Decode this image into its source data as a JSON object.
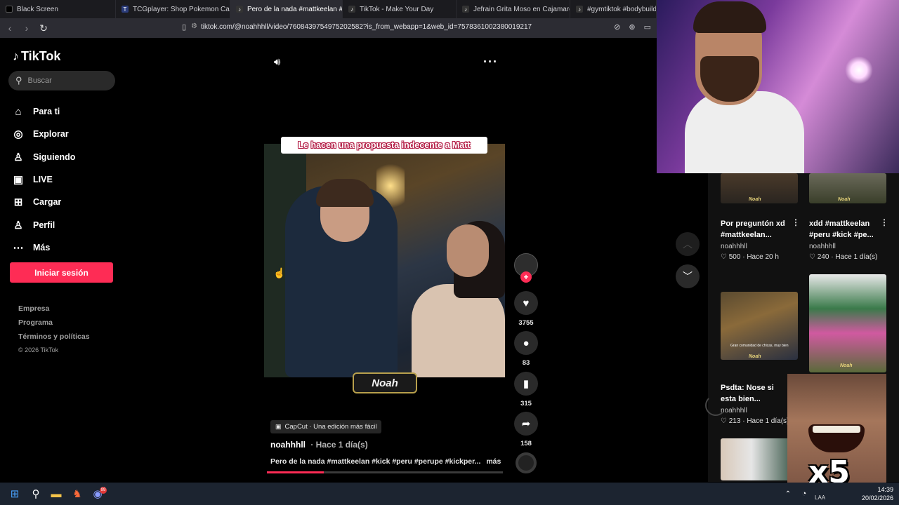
{
  "browser": {
    "tabs": [
      {
        "label": "Black Screen",
        "icon": "black-square-icon",
        "active": false
      },
      {
        "label": "TCGplayer: Shop Pokemon Cards, Pe",
        "icon": "tcg-icon",
        "active": false
      },
      {
        "label": "Pero de la nada #mattkeelan #k",
        "icon": "tiktok-icon",
        "active": true
      },
      {
        "label": "TikTok - Make Your Day",
        "icon": "tiktok-icon",
        "active": false
      },
      {
        "label": "Jefrain Grita Moso en Cajamarca | Ti",
        "icon": "tiktok-icon",
        "active": false
      },
      {
        "label": "#gymtiktok #bodybuilding",
        "icon": "tiktok-icon",
        "active": false
      }
    ],
    "url": "tiktok.com/@noahhhll/video/7608439754975202582?is_from_webapp=1&web_id=7578361002380019217"
  },
  "sidebar": {
    "logo": "TikTok",
    "search_placeholder": "Buscar",
    "nav": [
      {
        "label": "Para ti",
        "icon": "home-icon"
      },
      {
        "label": "Explorar",
        "icon": "compass-icon"
      },
      {
        "label": "Siguiendo",
        "icon": "following-icon"
      },
      {
        "label": "LIVE",
        "icon": "live-icon"
      },
      {
        "label": "Cargar",
        "icon": "upload-icon"
      },
      {
        "label": "Perfil",
        "icon": "profile-icon"
      },
      {
        "label": "Más",
        "icon": "more-icon"
      }
    ],
    "login_label": "Iniciar sesión",
    "footer": {
      "company": "Empresa",
      "program": "Programa",
      "terms": "Términos y políticas",
      "copyright": "© 2026 TikTok"
    }
  },
  "video": {
    "overlay_caption": "Le hacen una propuesta indecente a Matt",
    "watermark": "Noah",
    "likes": "3755",
    "comments": "83",
    "saves": "315",
    "shares": "158",
    "capcut": "CapCut · Una edición más fácil",
    "author": "noahhhll",
    "time": "· Hace 1 día(s)",
    "description": "Pero de la nada #mattkeelan #kick #peru #perupe #kickper...",
    "more": "más",
    "progress_percent": 24
  },
  "related": [
    {
      "title1": "Por preguntón xd",
      "title2": "#mattkeelan...",
      "author": "noahhhll",
      "likes": "500",
      "time": "Hace 20 h"
    },
    {
      "title1": "xdd #mattkeelan",
      "title2": "#peru #kick #pe...",
      "author": "noahhhll",
      "likes": "240",
      "time": "Hace 1 día(s)"
    },
    {
      "title1": "Psdta: Nose si",
      "title2": "esta bien...",
      "author": "noahhhll",
      "likes": "213",
      "time": "Hace 1 día(s)"
    }
  ],
  "thumb_captions": {
    "noah": "Noah",
    "sub": "Gran comunidad de chicas, muy bien"
  },
  "overlay": {
    "multiplier": "x5"
  },
  "taskbar": {
    "time": "14:39",
    "date": "20/02/2026",
    "lang": "LAA",
    "badge": "99"
  },
  "colors": {
    "accent": "#fe2c55",
    "background": "#000000"
  }
}
